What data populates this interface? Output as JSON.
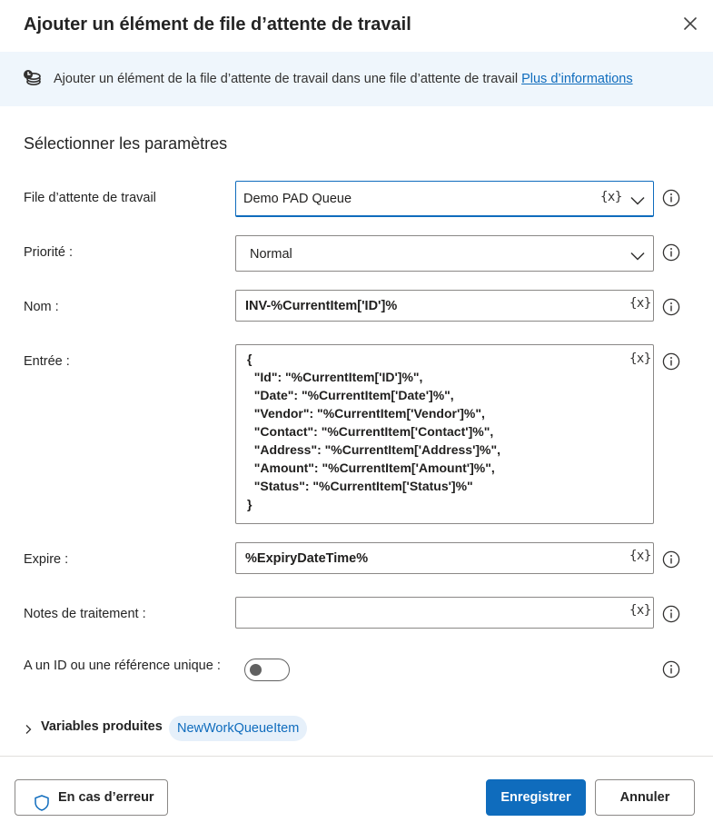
{
  "dialog": {
    "title": "Ajouter un élément de file d’attente de travail"
  },
  "banner": {
    "text": "Ajouter un élément de la file d’attente de travail dans une file d’attente de travail",
    "link": "Plus d’informations"
  },
  "section_title": "Sélectionner les paramètres",
  "var_token": "{x}",
  "fields": {
    "work_queue": {
      "label": "File d’attente de travail",
      "value": "Demo PAD Queue"
    },
    "priority": {
      "label": "Priorité :",
      "value": "Normal"
    },
    "name": {
      "label": "Nom :",
      "value": "INV-%CurrentItem['ID']%"
    },
    "input": {
      "label": "Entrée :",
      "lines": [
        "{",
        "  \"Id\": \"%CurrentItem['ID']%\",",
        "  \"Date\": \"%CurrentItem['Date']%\",",
        "  \"Vendor\": \"%CurrentItem['Vendor']%\",",
        "  \"Contact\": \"%CurrentItem['Contact']%\",",
        "  \"Address\": \"%CurrentItem['Address']%\",",
        "  \"Amount\": \"%CurrentItem['Amount']%\",",
        "  \"Status\": \"%CurrentItem['Status']%\"",
        "}"
      ]
    },
    "expires": {
      "label": "Expire :",
      "value": "%ExpiryDateTime%"
    },
    "processing_notes": {
      "label": "Notes de traitement :",
      "value": ""
    },
    "unique_id": {
      "label": "A un ID ou une référence unique :",
      "enabled": false
    }
  },
  "produced_variables": {
    "label": "Variables produites",
    "items": [
      "NewWorkQueueItem"
    ]
  },
  "footer": {
    "on_error": "En cas d’erreur",
    "save": "Enregistrer",
    "cancel": "Annuler"
  },
  "colors": {
    "accent": "#0f6cbd",
    "banner_bg": "#eff6fc",
    "pill_bg": "#e6f0fa"
  }
}
